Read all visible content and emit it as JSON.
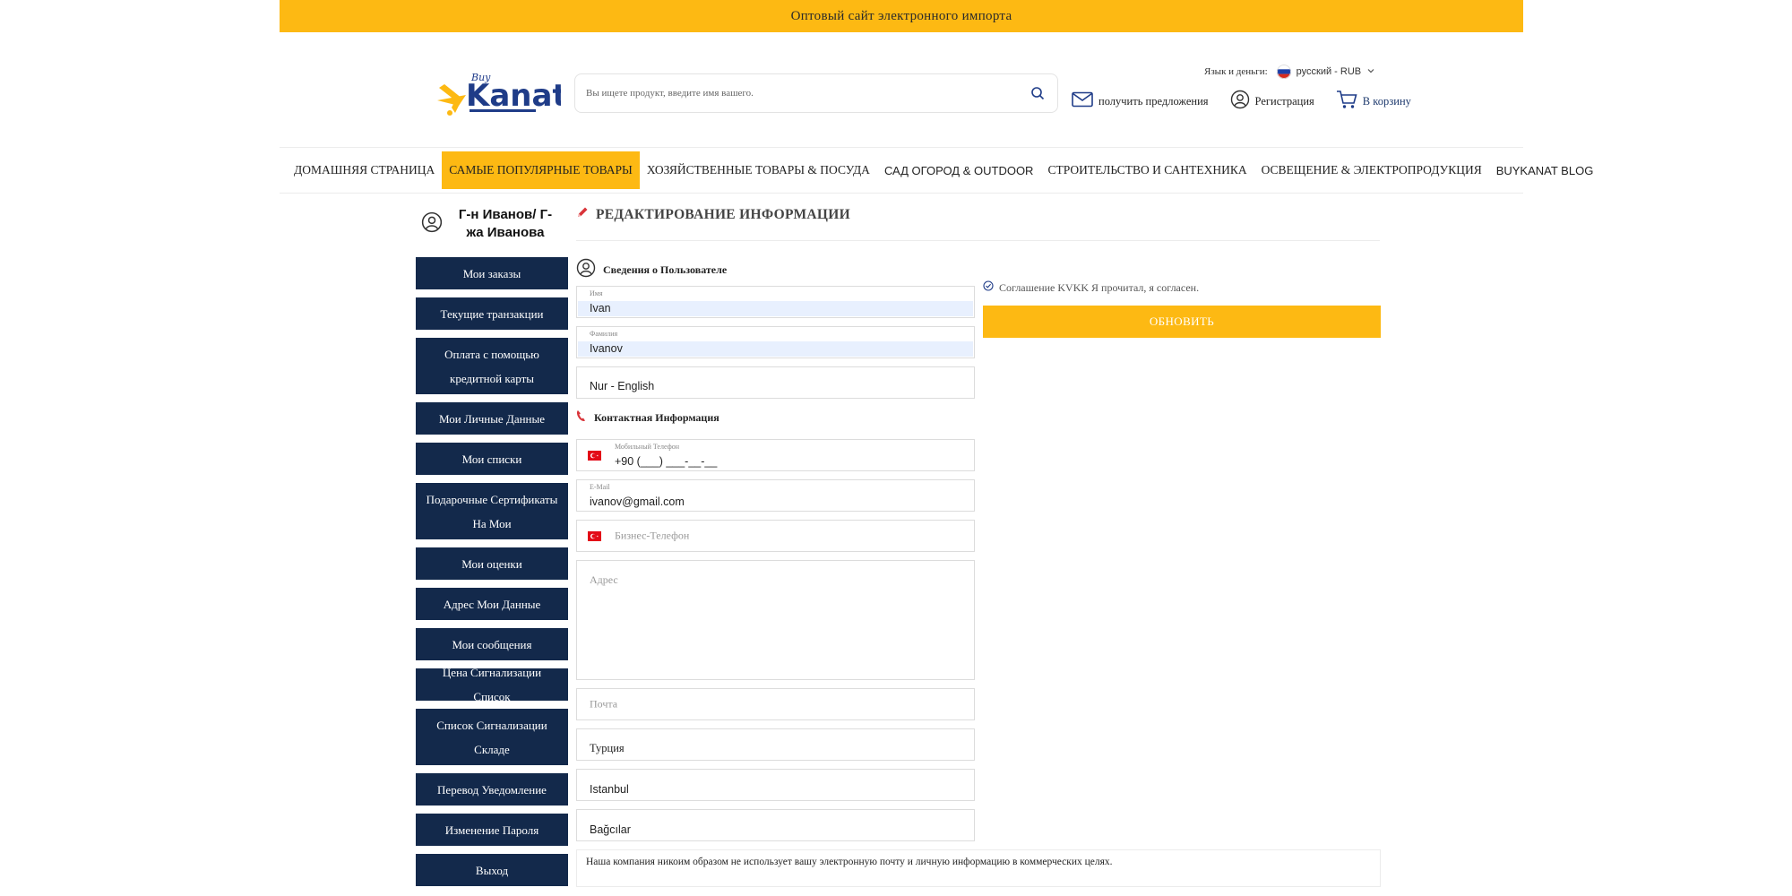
{
  "topbar": {
    "text": "Оптовый сайт электронного импорта"
  },
  "logo": {
    "brand": "Kanat",
    "prefix": "Buy"
  },
  "search": {
    "placeholder": "Вы ищете продукт, введите имя вашего."
  },
  "header": {
    "lang_label": "Язык и деньги:",
    "lang_value": "русский - RUB",
    "offers": "получить предложения",
    "register": "Регистрация",
    "cart": "В корзину"
  },
  "nav": [
    "ДОМАШНЯЯ СТРАНИЦА",
    "САМЫЕ ПОПУЛЯРНЫЕ ТОВАРЫ",
    "ХОЗЯЙСТВЕННЫЕ ТОВАРЫ & ПОСУДА",
    "САД ОГОРОД & OUTDOOR",
    "СТРОИТЕЛЬСТВО И САНТЕХНИКА",
    "ОСВЕЩЕНИЕ & ЭЛЕКТРОПРОДУКЦИЯ",
    "BUYKANAT BLOG"
  ],
  "user": {
    "name": "Г-н Иванов/ Г-жа Иванова"
  },
  "sidebar": [
    "Мои заказы",
    "Текущие транзакции",
    "Оплата с помощью кредитной карты",
    "Мои Личные Данные",
    "Мои списки",
    "Подарочные Сертификаты На Мои",
    "Мои оценки",
    "Адрес Мои Данные",
    "Мои сообщения",
    "Цена Сигнализации Список",
    "Список Сигнализации Складе",
    "Перевод Уведомление",
    "Изменение Пароля",
    "Выход"
  ],
  "page": {
    "title": "РЕДАКТИРОВАНИЕ ИНФОРМАЦИИ",
    "section_user": "Сведения о Пользователе",
    "section_contact": "Контактная Информация",
    "kvkk": "Соглашение KVKK Я прочитал, я согласен.",
    "update": "ОБНОВИТЬ",
    "notice": "Наша компания никоим образом не использует вашу электронную почту и личную информацию в коммерческих целях."
  },
  "form": {
    "first_name": {
      "label": "Имя",
      "value": "Ivan"
    },
    "last_name": {
      "label": "Фамилия",
      "value": "Ivanov"
    },
    "language": {
      "value": "Nur - English"
    },
    "mobile": {
      "label": "Мобильный Телефон",
      "value": "+90 (___) ___-__-__"
    },
    "email": {
      "label": "E-Mail",
      "value": "ivanov@gmail.com"
    },
    "business_phone": {
      "placeholder": "Бизнес-Телефон"
    },
    "address": {
      "placeholder": "Адрес"
    },
    "postal": {
      "placeholder": "Почта"
    },
    "country": {
      "value": "Турция"
    },
    "city": {
      "value": "Istanbul"
    },
    "district": {
      "value": "Bağcılar"
    }
  },
  "colors": {
    "accent": "#fdb913",
    "sidebar": "#13294b"
  }
}
